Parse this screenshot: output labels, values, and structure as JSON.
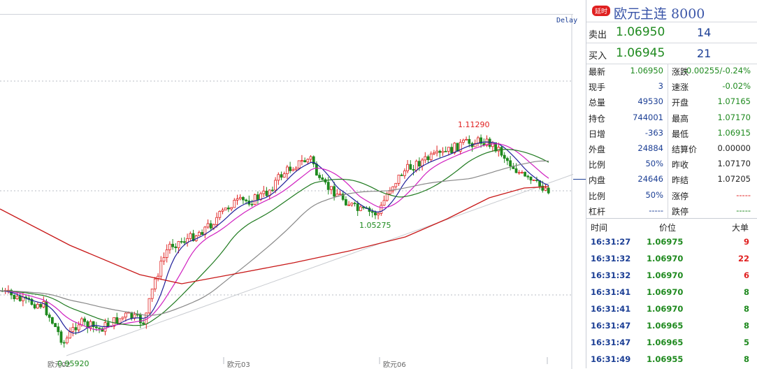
{
  "chart": {
    "delay_label": "Delay",
    "x_labels": [
      "欧元02",
      "欧元03",
      "欧元06"
    ],
    "high_label": "1.11290",
    "mid_low_label": "1.05275",
    "low_label": "0.95920"
  },
  "panel": {
    "badge": "延时",
    "title": "欧元主连  8000",
    "sell": {
      "label": "卖出",
      "price": "1.06950",
      "volume": "14"
    },
    "buy": {
      "label": "买入",
      "price": "1.06945",
      "volume": "21"
    },
    "stats_left": [
      {
        "label": "最新",
        "value": "1.06950",
        "color": "#1f8a1f"
      },
      {
        "label": "现手",
        "value": "3",
        "color": "#1c3f95"
      },
      {
        "label": "总量",
        "value": "49530",
        "color": "#1c3f95"
      },
      {
        "label": "持仓",
        "value": "744001",
        "color": "#1c3f95"
      },
      {
        "label": "日增",
        "value": "-363",
        "color": "#1c3f95"
      },
      {
        "label": "外盘",
        "value": "24884",
        "color": "#1c3f95"
      },
      {
        "label": "比例",
        "value": "50%",
        "color": "#1c3f95"
      },
      {
        "label": "内盘",
        "value": "24646",
        "color": "#1c3f95"
      },
      {
        "label": "比例",
        "value": "50%",
        "color": "#1c3f95"
      },
      {
        "label": "杠杆",
        "value": "-----",
        "color": "#1c3f95"
      }
    ],
    "stats_right": [
      {
        "label": "涨跌",
        "value": "-0.00255/-0.24%",
        "color": "#1f8a1f"
      },
      {
        "label": "速涨",
        "value": "-0.02%",
        "color": "#1f8a1f"
      },
      {
        "label": "开盘",
        "value": "1.07165",
        "color": "#1f8a1f"
      },
      {
        "label": "最高",
        "value": "1.07170",
        "color": "#1f8a1f"
      },
      {
        "label": "最低",
        "value": "1.06915",
        "color": "#1f8a1f"
      },
      {
        "label": "结算价",
        "value": "0.00000",
        "color": "#222"
      },
      {
        "label": "昨收",
        "value": "1.07170",
        "color": "#222"
      },
      {
        "label": "昨结",
        "value": "1.07205",
        "color": "#222"
      },
      {
        "label": "涨停",
        "value": "-----",
        "color": "#e02020"
      },
      {
        "label": "跌停",
        "value": "-----",
        "color": "#1f8a1f"
      }
    ],
    "trades_header": {
      "time": "时间",
      "price": "价位",
      "size": "大单"
    },
    "trades": [
      {
        "time": "16:31:27",
        "price": "1.06975",
        "size": "9",
        "color": "#e02020"
      },
      {
        "time": "16:31:32",
        "price": "1.06970",
        "size": "22",
        "color": "#e02020"
      },
      {
        "time": "16:31:32",
        "price": "1.06970",
        "size": "6",
        "color": "#e02020"
      },
      {
        "time": "16:31:41",
        "price": "1.06970",
        "size": "8",
        "color": "#1f8a1f"
      },
      {
        "time": "16:31:41",
        "price": "1.06970",
        "size": "8",
        "color": "#1f8a1f"
      },
      {
        "time": "16:31:47",
        "price": "1.06965",
        "size": "8",
        "color": "#1f8a1f"
      },
      {
        "time": "16:31:47",
        "price": "1.06965",
        "size": "5",
        "color": "#1f8a1f"
      },
      {
        "time": "16:31:49",
        "price": "1.06955",
        "size": "8",
        "color": "#1f8a1f"
      }
    ]
  }
}
